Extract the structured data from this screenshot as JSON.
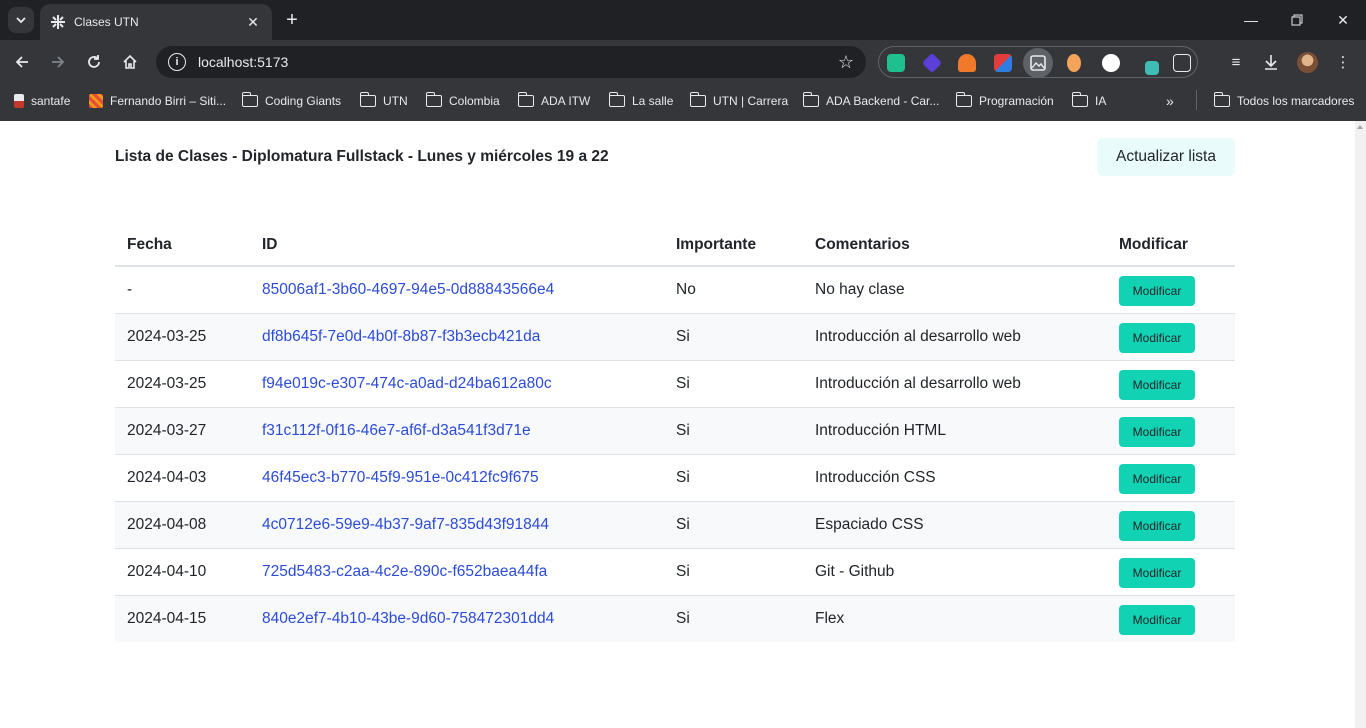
{
  "browser": {
    "tab_title": "Clases UTN",
    "url": "localhost:5173",
    "bookmarks": [
      {
        "label": "santafe",
        "kind": "site"
      },
      {
        "label": "Fernando Birri – Siti...",
        "kind": "site"
      },
      {
        "label": "Coding Giants",
        "kind": "folder"
      },
      {
        "label": "UTN",
        "kind": "folder"
      },
      {
        "label": "Colombia",
        "kind": "folder"
      },
      {
        "label": "ADA ITW",
        "kind": "folder"
      },
      {
        "label": "La salle",
        "kind": "folder"
      },
      {
        "label": "UTN | Carrera",
        "kind": "folder"
      },
      {
        "label": "ADA Backend - Car...",
        "kind": "folder"
      },
      {
        "label": "Programación",
        "kind": "folder"
      },
      {
        "label": "IA",
        "kind": "folder"
      }
    ],
    "all_bookmarks_label": "Todos los marcadores"
  },
  "page": {
    "title": "Lista de Clases - Diplomatura Fullstack - Lunes y miércoles 19 a 22",
    "refresh_label": "Actualizar lista"
  },
  "table": {
    "headers": {
      "fecha": "Fecha",
      "id": "ID",
      "importante": "Importante",
      "comentarios": "Comentarios",
      "modificar": "Modificar"
    },
    "rows": [
      {
        "fecha": "-",
        "id": "85006af1-3b60-4697-94e5-0d88843566e4",
        "importante": "No",
        "comentarios": "No hay clase",
        "action": "Modificar"
      },
      {
        "fecha": "2024-03-25",
        "id": "df8b645f-7e0d-4b0f-8b87-f3b3ecb421da",
        "importante": "Si",
        "comentarios": "Introducción al desarrollo web",
        "action": "Modificar"
      },
      {
        "fecha": "2024-03-25",
        "id": "f94e019c-e307-474c-a0ad-d24ba612a80c",
        "importante": "Si",
        "comentarios": "Introducción al desarrollo web",
        "action": "Modificar"
      },
      {
        "fecha": "2024-03-27",
        "id": "f31c112f-0f16-46e7-af6f-d3a541f3d71e",
        "importante": "Si",
        "comentarios": "Introducción HTML",
        "action": "Modificar"
      },
      {
        "fecha": "2024-04-03",
        "id": "46f45ec3-b770-45f9-951e-0c412fc9f675",
        "importante": "Si",
        "comentarios": "Introducción CSS",
        "action": "Modificar"
      },
      {
        "fecha": "2024-04-08",
        "id": "4c0712e6-59e9-4b37-9af7-835d43f91844",
        "importante": "Si",
        "comentarios": "Espaciado CSS",
        "action": "Modificar"
      },
      {
        "fecha": "2024-04-10",
        "id": "725d5483-c2aa-4c2e-890c-f652baea44fa",
        "importante": "Si",
        "comentarios": "Git - Github",
        "action": "Modificar"
      },
      {
        "fecha": "2024-04-15",
        "id": "840e2ef7-4b10-43be-9d60-758472301dd4",
        "importante": "Si",
        "comentarios": "Flex",
        "action": "Modificar"
      }
    ]
  },
  "colors": {
    "accent_button": "#11d3b4",
    "refresh_button_bg": "#e9fbfb",
    "link": "#2b4bd9",
    "chrome_dark": "#202124",
    "chrome_toolbar": "#35363a"
  }
}
